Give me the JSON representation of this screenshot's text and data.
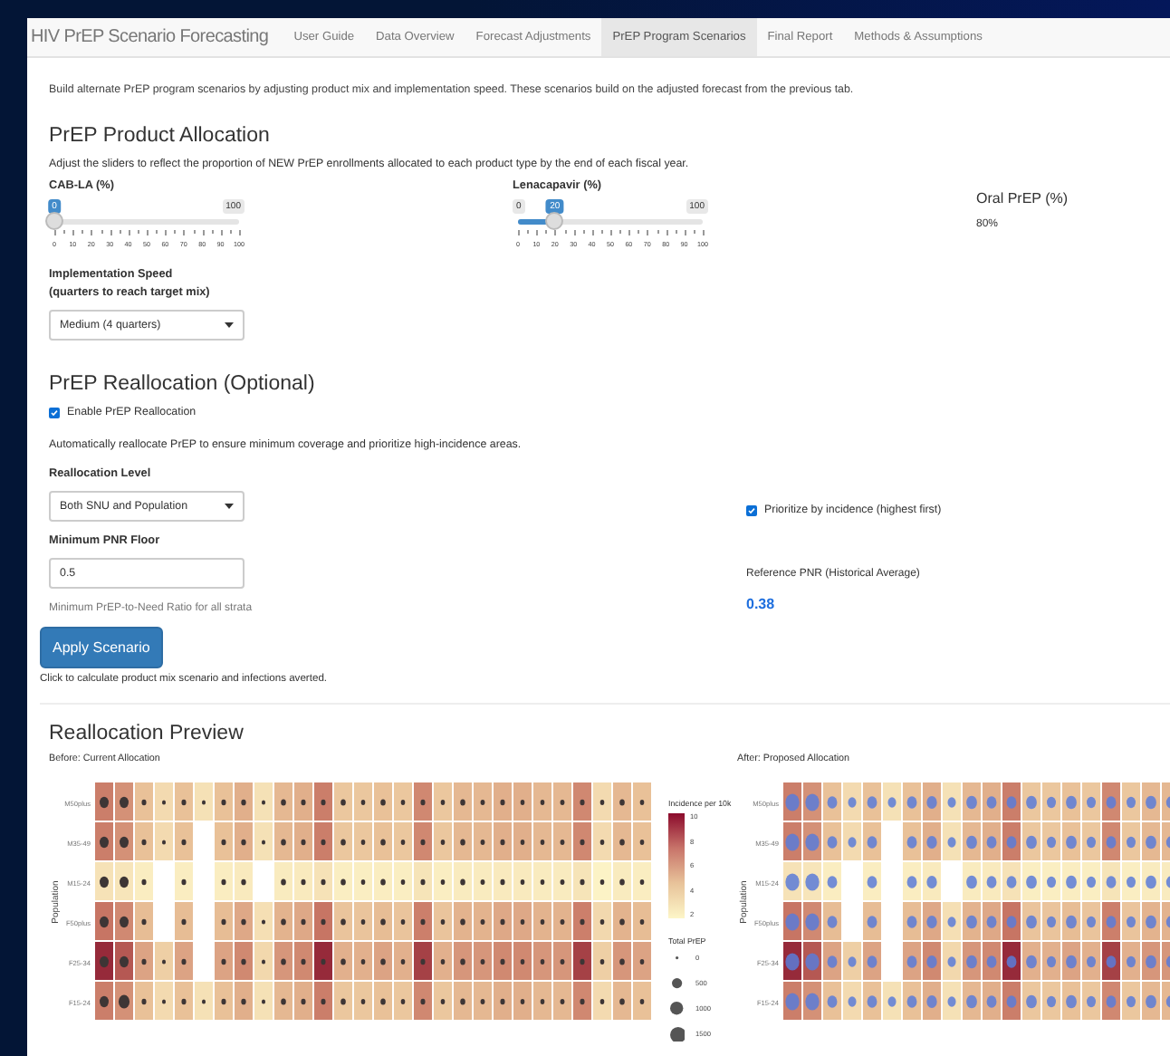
{
  "navbar": {
    "brand": "HIV PrEP Scenario Forecasting",
    "tabs": [
      {
        "label": "User Guide",
        "selected": false
      },
      {
        "label": "Data Overview",
        "selected": false
      },
      {
        "label": "Forecast Adjustments",
        "selected": false
      },
      {
        "label": "PrEP Program Scenarios",
        "selected": true
      },
      {
        "label": "Final Report",
        "selected": false
      },
      {
        "label": "Methods & Assumptions",
        "selected": false
      }
    ]
  },
  "intro": "Build alternate PrEP program scenarios by adjusting product mix and implementation speed. These scenarios build on the adjusted forecast from the previous tab.",
  "allocation": {
    "title": "PrEP Product Allocation",
    "description": "Adjust the sliders to reflect the proportion of NEW PrEP enrollments allocated to each product type by the end of each fiscal year.",
    "sliders": [
      {
        "label": "CAB-LA (%)",
        "max_label": "100",
        "value_label": "0",
        "level": 0,
        "ticks": [
          "0",
          "10",
          "20",
          "30",
          "40",
          "50",
          "60",
          "70",
          "80",
          "90",
          "100"
        ]
      },
      {
        "label": "Lenacapavir (%)",
        "min_label": "0",
        "max_label": "100",
        "value_label": "20",
        "level": 0.2,
        "ticks": [
          "0",
          "10",
          "20",
          "30",
          "40",
          "50",
          "60",
          "70",
          "80",
          "90",
          "100"
        ]
      }
    ],
    "oral": {
      "label": "Oral PrEP (%)",
      "value": "80%"
    },
    "speed": {
      "label": "Implementation Speed (quarters to reach target mix)",
      "value": "Medium (4 quarters)"
    }
  },
  "reallocation": {
    "title": "PrEP Reallocation (Optional)",
    "enable": {
      "label": "Enable PrEP Reallocation",
      "checked": true
    },
    "description": "Automatically reallocate PrEP to ensure minimum coverage and prioritize high-incidence areas.",
    "level": {
      "label": "Reallocation Level",
      "value": "Both SNU and Population"
    },
    "prioritize": {
      "label": "Prioritize by incidence (highest first)",
      "checked": true
    },
    "floor": {
      "label": "Minimum PNR Floor",
      "value": "0.5",
      "help": "Minimum PrEP-to-Need Ratio for all strata"
    },
    "reference": {
      "label": "Reference PNR (Historical Average)",
      "value": "0.38"
    },
    "apply_button": "Apply Scenario",
    "apply_help": "Click to calculate product mix scenario and infections averted."
  },
  "preview": {
    "title": "Reallocation Preview",
    "heatmaps": [
      {
        "kind": "before",
        "title": "Before: Current Allocation",
        "ylabel": "Population",
        "rows": [
          "M50plus",
          "M35-49",
          "M15-24",
          "F50plus",
          "F25-34",
          "F15-24"
        ],
        "legend": {
          "fill_title": "Incidence per 10k",
          "fill_ticks": [
            "10",
            "8",
            "6",
            "4",
            "2"
          ],
          "size_title": "Total PrEP",
          "size_ticks": [
            "0",
            "500",
            "1000",
            "1500"
          ]
        }
      },
      {
        "kind": "after",
        "title": "After: Proposed Allocation",
        "ylabel": "Population",
        "rows": [
          "M50plus",
          "M35-49",
          "M15-24",
          "F50plus",
          "F25-34",
          "F15-24"
        ]
      }
    ]
  }
}
